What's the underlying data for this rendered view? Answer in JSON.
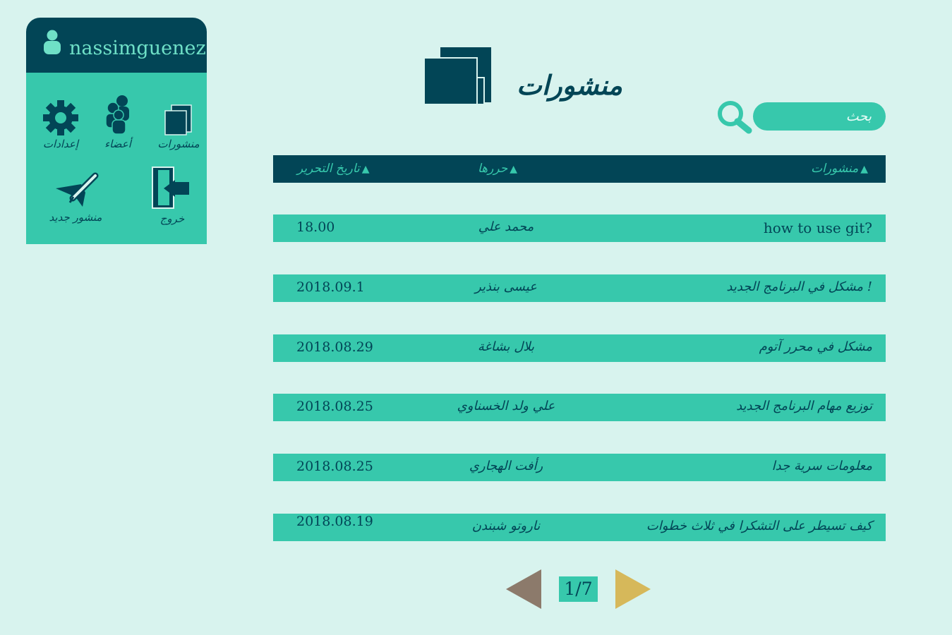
{
  "user": {
    "name": "nassimguenez"
  },
  "sidebar": {
    "posts_label": "منشورات",
    "members_label": "أعضاء",
    "settings_label": "إعدادات",
    "new_post_label": "منشور جديد",
    "logout_label": "خروج"
  },
  "page": {
    "title": "منشورات"
  },
  "search": {
    "placeholder": "بحث"
  },
  "table": {
    "headers": {
      "title": "منشورات",
      "author": "حررها",
      "date": "تاريخ التحرير"
    },
    "sort_icon": "triangle-up",
    "rows": [
      {
        "title": "how to use git?",
        "author": "محمد علي",
        "date": "18.00"
      },
      {
        "title": "! مشكل في البرنامج الجديد",
        "author": "عيسى بنذير",
        "date": "2018.09.1"
      },
      {
        "title": "مشكل في محرر آتوم",
        "author": "بلال بشاغة",
        "date": "2018.08.29"
      },
      {
        "title": "توزيع مهام البرنامج الجديد",
        "author": "علي ولد الخسناوي",
        "date": "2018.08.25"
      },
      {
        "title": "معلومات سرية جدا",
        "author": "رأفت الهجاري",
        "date": "2018.08.25"
      },
      {
        "title": "كيف تسيطر على التشكرا في ثلاث خطوات",
        "author": "ناروتو شبندن",
        "date": "2018.08.19"
      }
    ]
  },
  "pagination": {
    "current": "1/7"
  },
  "colors": {
    "dark": "#024556",
    "accent": "#37c8ac",
    "background": "#d8f3ee",
    "prev": "#8c7a6b",
    "next": "#d6b85a"
  }
}
